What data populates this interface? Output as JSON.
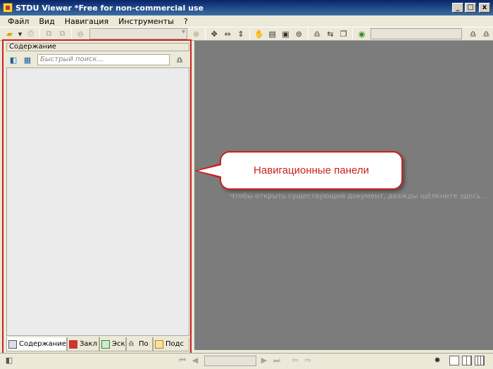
{
  "window": {
    "title": "STDU Viewer *Free for non-commercial use",
    "minimize": "_",
    "maximize": "□",
    "close": "x"
  },
  "menu": [
    {
      "label": "Файл"
    },
    {
      "label": "Вид"
    },
    {
      "label": "Навигация"
    },
    {
      "label": "Инструменты"
    },
    {
      "label": "?"
    }
  ],
  "toolbar": {
    "zoom_value": "",
    "search_value": ""
  },
  "panel": {
    "header": "Содержание",
    "quick_search_placeholder": "Быстрый поиск...",
    "tabs": [
      {
        "label": "Содержание",
        "active": true
      },
      {
        "label": "Закл"
      },
      {
        "label": "Эск"
      },
      {
        "label": "По"
      },
      {
        "label": "Подс"
      }
    ]
  },
  "workspace": {
    "hint": "Чтобы открыть существующий документ, дважды щёлкните здесь..."
  },
  "callout": {
    "text": "Навигационные панели"
  },
  "statusbar": {
    "page_value": ""
  },
  "colors": {
    "highlight": "#cc1f1f",
    "workspace_bg": "#7c7c7c",
    "panel_bg": "#ebebeb",
    "chrome": "#ece9d8"
  }
}
